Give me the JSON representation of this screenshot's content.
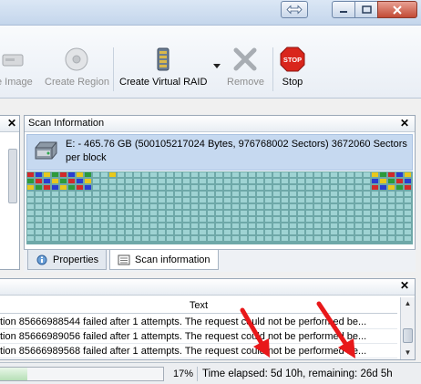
{
  "toolbar": {
    "items": [
      {
        "label": "e Image",
        "icon": "disk-image-icon",
        "disabled": true
      },
      {
        "label": "Create Region",
        "icon": "create-region-icon",
        "disabled": true
      },
      {
        "label": "Create Virtual RAID",
        "icon": "virtual-raid-icon",
        "disabled": false
      },
      {
        "label": "Remove",
        "icon": "remove-icon",
        "disabled": true
      },
      {
        "label": "Stop",
        "icon": "stop-icon",
        "disabled": false
      }
    ],
    "stop_sign_text": "STOP"
  },
  "scan_panel": {
    "title": "Scan Information",
    "disk_line1": "E: - 465.76 GB (500105217024 Bytes, 976768002 Sectors) 3672060 Sectors",
    "disk_line2": "per block",
    "selection_color": "#c6d9f0",
    "grid_color": "#6ea8a8"
  },
  "tabs": [
    {
      "label": "Properties",
      "icon": "properties-icon",
      "active": false
    },
    {
      "label": "Scan information",
      "icon": "scan-information-icon",
      "active": true
    }
  ],
  "log": {
    "column_header": "Text",
    "rows": [
      "tion 85666988544 failed after 1 attempts. The request could not be performed be...",
      "tion 85666989056 failed after 1 attempts. The request could not be performed be...",
      "tion 85666989568 failed after 1 attempts. The request could not be performed be..."
    ]
  },
  "status": {
    "progress_percent": 17,
    "percent_label": "17%",
    "elapsed_text": "Time elapsed: 5d 10h, remaining: 26d 5h"
  },
  "colors": {
    "annotation_arrow": "#e8181a",
    "stop_sign": "#d9261c"
  }
}
